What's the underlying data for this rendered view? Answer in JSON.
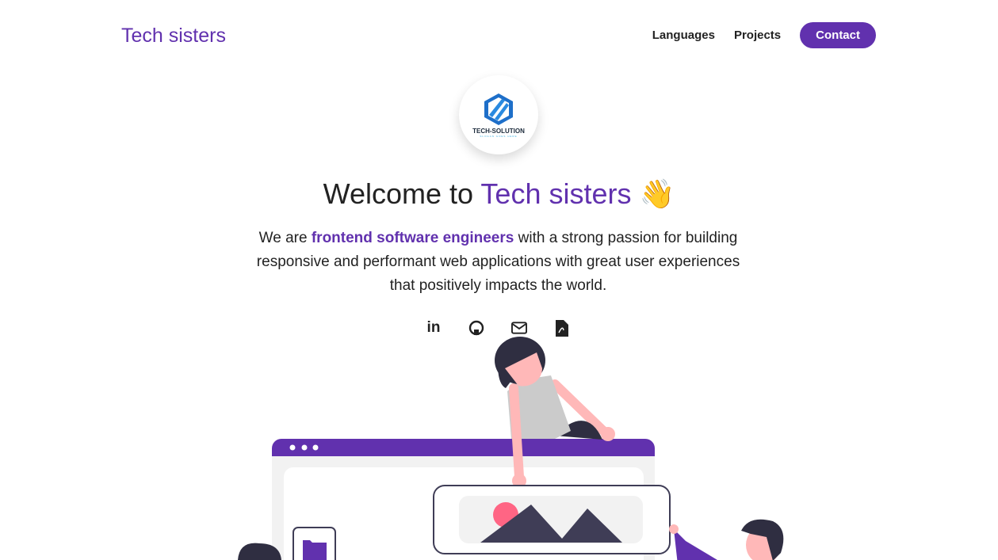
{
  "header": {
    "brand": "Tech sisters",
    "nav": [
      {
        "label": "Languages"
      },
      {
        "label": "Projects"
      },
      {
        "label": "Contact"
      }
    ]
  },
  "logo": {
    "title": "TECH-SOLUTION",
    "slogan": "SLOGAN GOES HERE"
  },
  "hero": {
    "title_prefix": "Welcome to ",
    "title_highlight": "Tech sisters",
    "title_emoji": "👋",
    "intro_before": "We are ",
    "intro_highlight": "frontend software engineers",
    "intro_after": " with a strong passion for building responsive and performant web applications with great user experiences that positively impacts the world."
  },
  "socials": [
    {
      "icon": "linkedin-icon",
      "text": "in"
    },
    {
      "icon": "github-icon"
    },
    {
      "icon": "mail-icon"
    },
    {
      "icon": "pdf-icon"
    }
  ],
  "colors": {
    "accent": "#6131ae",
    "pink": "#ff6584",
    "dark": "#3f3d56"
  }
}
